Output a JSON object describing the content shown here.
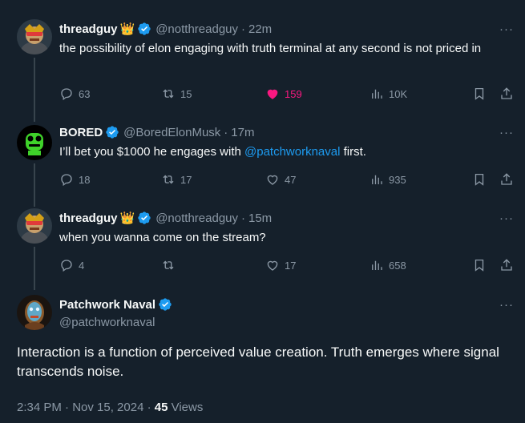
{
  "tweets": [
    {
      "name": "threadguy",
      "handle": "@notthreadguy",
      "time": "22m",
      "text": "the possibility of elon engaging with truth terminal at any second is not priced in",
      "replies": "63",
      "reposts": "15",
      "likes": "159",
      "views": "10K"
    },
    {
      "name": "BORED",
      "handle": "@BoredElonMusk",
      "time": "17m",
      "text_before": "I’ll bet you $1000 he engages with ",
      "mention": "@patchworknaval",
      "text_after": " first.",
      "replies": "18",
      "reposts": "17",
      "likes": "47",
      "views": "935"
    },
    {
      "name": "threadguy",
      "handle": "@notthreadguy",
      "time": "15m",
      "text": "when you wanna come on the stream?",
      "replies": "4",
      "reposts": "",
      "likes": "17",
      "views": "658"
    }
  ],
  "main_tweet": {
    "name": "Patchwork Naval",
    "handle": "@patchworknaval",
    "text": "Interaction is a function of perceived value creation. Truth emerges where signal transcends noise.",
    "timestamp": "2:34 PM · Nov 15, 2024 · ",
    "views_count": "45",
    "views_label": " Views"
  },
  "ui": {
    "dot": "·",
    "more": "···",
    "crown": "👑"
  },
  "colors": {
    "background": "#15202b",
    "accent": "#1d9bf0",
    "like": "#f91880",
    "muted": "#8b98a5"
  }
}
